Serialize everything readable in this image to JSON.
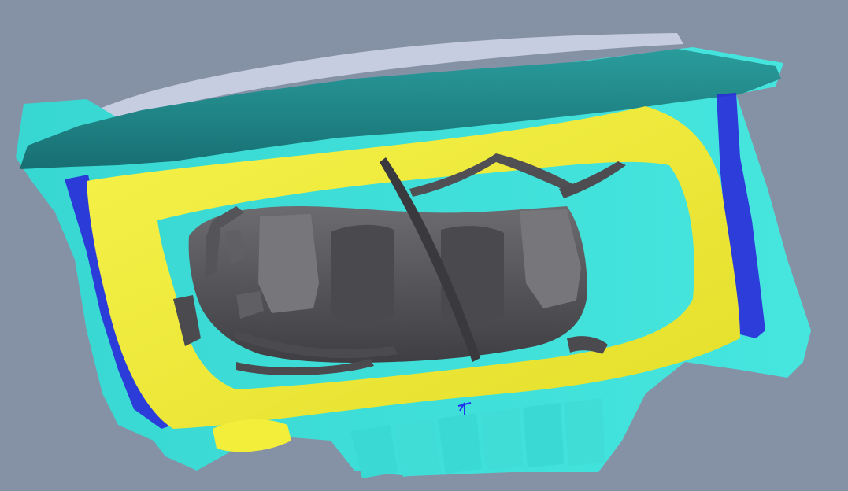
{
  "viewport": {
    "background": "#8592a6",
    "model": {
      "parts": [
        {
          "name": "cowl-panel",
          "color": "#1f8a8a"
        },
        {
          "name": "frame-outer",
          "color": "#3ee0d8"
        },
        {
          "name": "engine-bay-surround",
          "color": "#f2ee3a"
        },
        {
          "name": "engine-assembly",
          "color": "#5a5a5e"
        },
        {
          "name": "side-brackets",
          "color": "#2a2ad8"
        },
        {
          "name": "top-trim-strip",
          "color": "#c7cde0"
        }
      ]
    },
    "gizmo": {
      "color": "#2233ee",
      "icon": "axis-gizmo-icon"
    }
  }
}
